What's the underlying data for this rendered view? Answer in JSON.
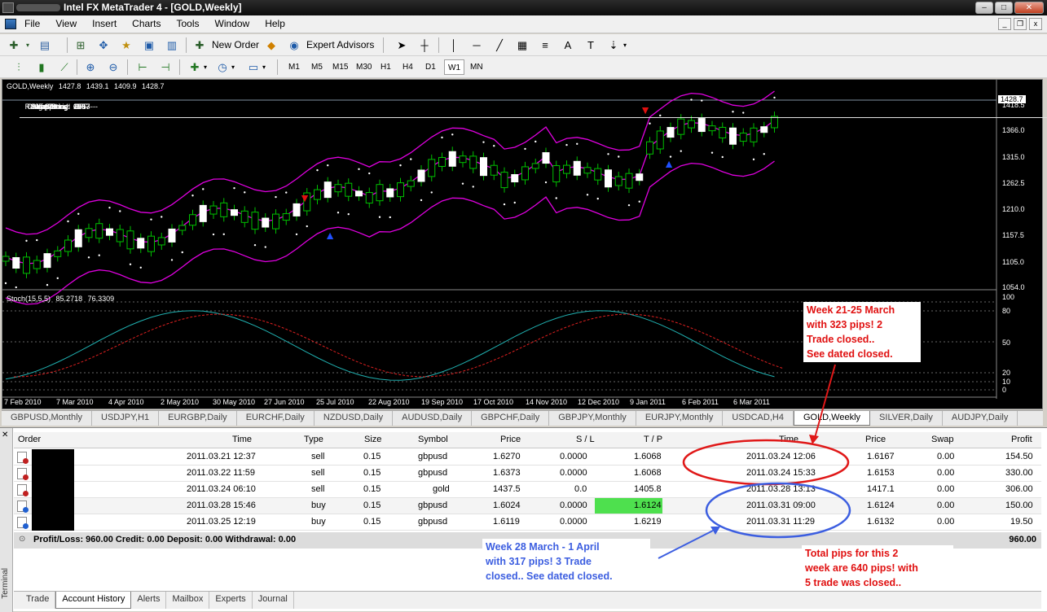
{
  "window": {
    "title": "Intel FX MetaTrader 4 - [GOLD,Weekly]",
    "minimize": "–",
    "restore": "□",
    "close": "✕"
  },
  "menu": [
    "File",
    "View",
    "Insert",
    "Charts",
    "Tools",
    "Window",
    "Help"
  ],
  "toolbar": {
    "new_order": "New Order",
    "expert_advisors": "Expert Advisors",
    "timeframes": [
      "M1",
      "M5",
      "M15",
      "M30",
      "H1",
      "H4",
      "D1",
      "W1",
      "MN"
    ],
    "active_timeframe": "W1"
  },
  "chart": {
    "symbol_header": "GOLD,Weekly",
    "ohlc": [
      "1427.8",
      "1439.1",
      "1409.9",
      "1428.7"
    ],
    "panel_title": "Panel",
    "panel_dashes": "----------",
    "panel": [
      {
        "k": "GMT Setting:",
        "v": "0"
      },
      {
        "k": "Range Today:",
        "v": "238"
      },
      {
        "k": "Yesterday:",
        "v": "190"
      },
      {
        "k": "Next bar in:",
        "v": "OFF"
      },
      {
        "k": "Swap Long:",
        "v": "-1.57"
      },
      {
        "k": "Swap Short:",
        "v": "-3.13"
      },
      {
        "k": "Spread:",
        "v": "10"
      }
    ],
    "current_price": "1428.7",
    "price_labels": [
      "1418.5",
      "1366.0",
      "1315.0",
      "1262.5",
      "1210.0",
      "1157.5",
      "1105.0",
      "1054.0"
    ],
    "stoch_header": "Stoch(15,5,5)",
    "stoch_values": [
      "85.2718",
      "76.3309"
    ],
    "stoch_levels": [
      "100",
      "80",
      "50",
      "20",
      "10",
      "0"
    ],
    "dates": [
      "7 Feb 2010",
      "7 Mar 2010",
      "4 Apr 2010",
      "2 May 2010",
      "30 May 2010",
      "27 Jun 2010",
      "25 Jul 2010",
      "22 Aug 2010",
      "19 Sep 2010",
      "17 Oct 2010",
      "14 Nov 2010",
      "12 Dec 2010",
      "9 Jan 2011",
      "6 Feb 2011",
      "6 Mar 2011"
    ],
    "colors": {
      "background": "#000000",
      "bull": "#00c000",
      "bands": "#e000e0",
      "stoch_main": "#20b0b0",
      "stoch_signal": "#e02020"
    }
  },
  "chart_tabs": [
    "GBPUSD,Monthly",
    "USDJPY,H1",
    "EURGBP,Daily",
    "EURCHF,Daily",
    "NZDUSD,Daily",
    "AUDUSD,Daily",
    "GBPCHF,Daily",
    "GBPJPY,Monthly",
    "EURJPY,Monthly",
    "USDCAD,H4",
    "GOLD,Weekly",
    "SILVER,Daily",
    "AUDJPY,Daily"
  ],
  "active_chart_tab": "GOLD,Weekly",
  "terminal": {
    "label": "Terminal",
    "close": "✕",
    "columns": [
      "Order",
      "Time",
      "Type",
      "Size",
      "Symbol",
      "Price",
      "S / L",
      "T / P",
      "Time",
      "Price",
      "Swap",
      "Profit"
    ],
    "rows": [
      {
        "open_time": "2011.03.21 12:37",
        "type": "sell",
        "size": "0.15",
        "symbol": "gbpusd",
        "price": "1.6270",
        "sl": "0.0000",
        "tp": "1.6068",
        "close_time": "2011.03.24 12:06",
        "close_price": "1.6167",
        "swap": "0.00",
        "profit": "154.50"
      },
      {
        "open_time": "2011.03.22 11:59",
        "type": "sell",
        "size": "0.15",
        "symbol": "gbpusd",
        "price": "1.6373",
        "sl": "0.0000",
        "tp": "1.6068",
        "close_time": "2011.03.24 15:33",
        "close_price": "1.6153",
        "swap": "0.00",
        "profit": "330.00"
      },
      {
        "open_time": "2011.03.24 06:10",
        "type": "sell",
        "size": "0.15",
        "symbol": "gold",
        "price": "1437.5",
        "sl": "0.0",
        "tp": "1405.8",
        "close_time": "2011.03.28 13:13",
        "close_price": "1417.1",
        "swap": "0.00",
        "profit": "306.00"
      },
      {
        "open_time": "2011.03.28 15:46",
        "type": "buy",
        "size": "0.15",
        "symbol": "gbpusd",
        "price": "1.6024",
        "sl": "0.0000",
        "tp": "1.6124",
        "close_time": "2011.03.31 09:00",
        "close_price": "1.6124",
        "swap": "0.00",
        "profit": "150.00"
      },
      {
        "open_time": "2011.03.25 12:19",
        "type": "buy",
        "size": "0.15",
        "symbol": "gbpusd",
        "price": "1.6119",
        "sl": "0.0000",
        "tp": "1.6219",
        "close_time": "2011.03.31 11:29",
        "close_price": "1.6132",
        "swap": "0.00",
        "profit": "19.50"
      }
    ],
    "summary": "Profit/Loss: 960.00  Credit: 0.00  Deposit: 0.00  Withdrawal: 0.00",
    "total": "960.00",
    "tabs": [
      "Trade",
      "Account History",
      "Alerts",
      "Mailbox",
      "Experts",
      "Journal"
    ],
    "active_tab": "Account History"
  },
  "annotations": {
    "week1": [
      "Week 21-25 March",
      "with 323 pips! 2",
      "Trade closed..",
      "See dated closed."
    ],
    "week2": [
      "Week 28 March - 1 April",
      "with 317 pips! 3 Trade",
      "closed.. See dated closed."
    ],
    "total": [
      "Total pips for this 2",
      "week are 640 pips! with",
      "5 trade was closed.."
    ]
  }
}
